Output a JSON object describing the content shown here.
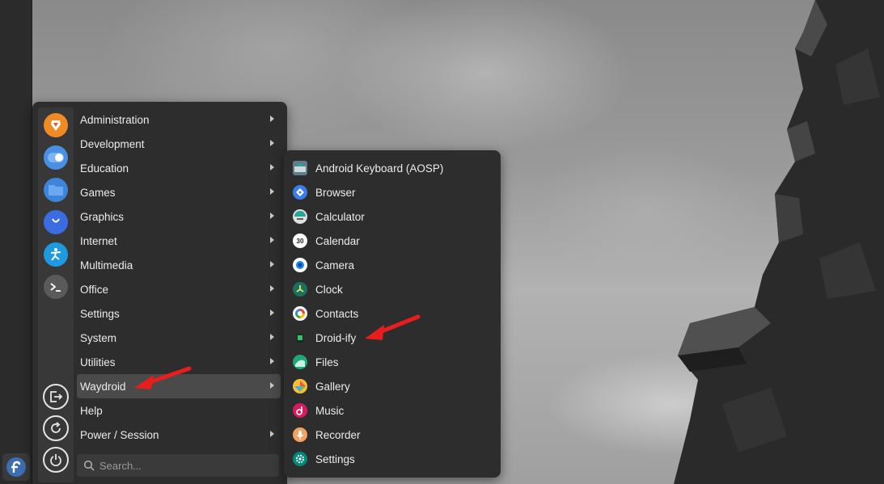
{
  "categories": [
    {
      "label": "Administration",
      "submenu": true
    },
    {
      "label": "Development",
      "submenu": true
    },
    {
      "label": "Education",
      "submenu": true
    },
    {
      "label": "Games",
      "submenu": true
    },
    {
      "label": "Graphics",
      "submenu": true
    },
    {
      "label": "Internet",
      "submenu": true
    },
    {
      "label": "Multimedia",
      "submenu": true
    },
    {
      "label": "Office",
      "submenu": true
    },
    {
      "label": "Settings",
      "submenu": true
    },
    {
      "label": "System",
      "submenu": true
    },
    {
      "label": "Utilities",
      "submenu": true
    },
    {
      "label": "Waydroid",
      "submenu": true,
      "active": true
    },
    {
      "label": "Help",
      "submenu": false
    },
    {
      "label": "Power / Session",
      "submenu": true
    }
  ],
  "search": {
    "placeholder": "Search..."
  },
  "favorites": [
    "brave-icon",
    "toggle-icon",
    "folder-icon",
    "store-bag-icon",
    "accessibility-icon",
    "terminal-icon"
  ],
  "session_buttons": [
    "logout-icon",
    "restart-icon",
    "power-icon"
  ],
  "waydroid_apps": [
    {
      "label": "Android Keyboard (AOSP)",
      "icon": "keyboard-icon"
    },
    {
      "label": "Browser",
      "icon": "browser-icon"
    },
    {
      "label": "Calculator",
      "icon": "calculator-icon"
    },
    {
      "label": "Calendar",
      "icon": "calendar-icon"
    },
    {
      "label": "Camera",
      "icon": "camera-icon"
    },
    {
      "label": "Clock",
      "icon": "clock-icon"
    },
    {
      "label": "Contacts",
      "icon": "contacts-icon"
    },
    {
      "label": "Droid-ify",
      "icon": "droidify-icon"
    },
    {
      "label": "Files",
      "icon": "files-icon"
    },
    {
      "label": "Gallery",
      "icon": "gallery-icon"
    },
    {
      "label": "Music",
      "icon": "music-icon"
    },
    {
      "label": "Recorder",
      "icon": "recorder-icon"
    },
    {
      "label": "Settings",
      "icon": "settings-icon"
    }
  ],
  "calendar_icon_text": "30",
  "colors": {
    "accent_arrow": "#e81e1e",
    "menu_bg": "#2d2d2d",
    "active_bg": "#4a4a4a"
  }
}
